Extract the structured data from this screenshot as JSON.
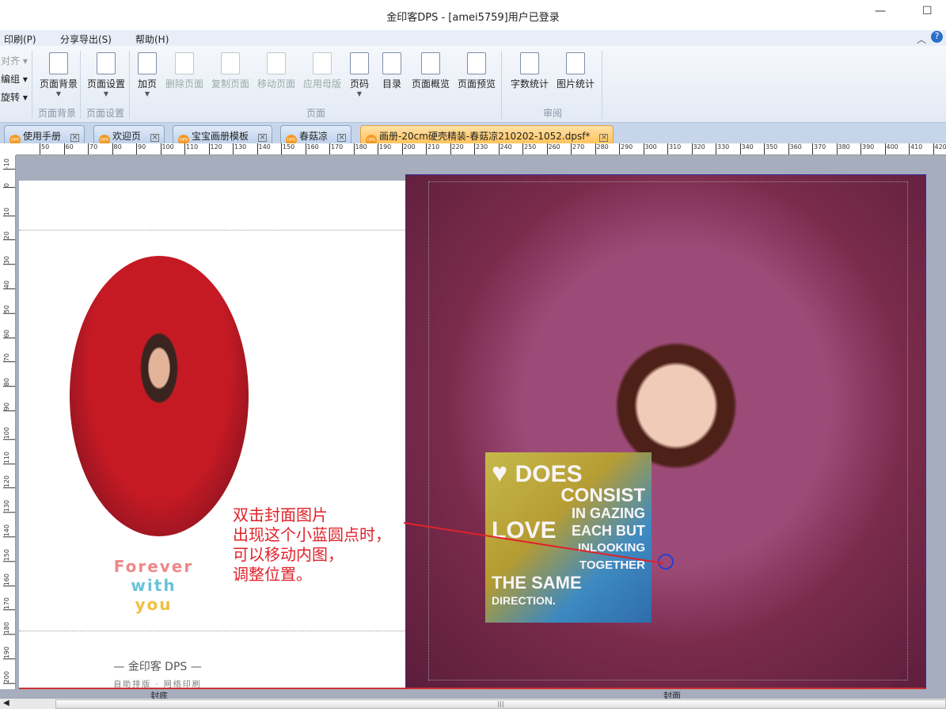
{
  "window": {
    "title": "金印客DPS - [amei5759]用户已登录",
    "minimize": "—",
    "maximize": "☐"
  },
  "menu": [
    "印刷(P)",
    "分享导出(S)",
    "帮助(H)"
  ],
  "side_tools": [
    "对齐",
    "编组",
    "旋转"
  ],
  "ribbon": {
    "buttons": [
      {
        "label": "页面背景",
        "icon": "page-background-icon",
        "enabled": true,
        "dropdown": true
      },
      {
        "label": "页面设置",
        "icon": "page-setup-icon",
        "enabled": true,
        "dropdown": true
      },
      {
        "label": "加页",
        "icon": "add-page-icon",
        "enabled": true,
        "dropdown": true
      },
      {
        "label": "删除页面",
        "icon": "delete-page-icon",
        "enabled": false
      },
      {
        "label": "复制页面",
        "icon": "copy-page-icon",
        "enabled": false
      },
      {
        "label": "移动页面",
        "icon": "move-page-icon",
        "enabled": false
      },
      {
        "label": "应用母版",
        "icon": "apply-master-icon",
        "enabled": false
      },
      {
        "label": "页码",
        "icon": "page-number-icon",
        "enabled": true,
        "dropdown": true
      },
      {
        "label": "目录",
        "icon": "toc-icon",
        "enabled": true
      },
      {
        "label": "页面概览",
        "icon": "page-overview-icon",
        "enabled": true
      },
      {
        "label": "页面预览",
        "icon": "page-preview-icon",
        "enabled": true
      },
      {
        "label": "字数统计",
        "icon": "word-count-icon",
        "enabled": true
      },
      {
        "label": "图片统计",
        "icon": "image-count-icon",
        "enabled": true
      }
    ],
    "groups": [
      "页面背景",
      "页面设置",
      "页面",
      "审阅"
    ]
  },
  "tabs": [
    {
      "label": "使用手册",
      "active": false
    },
    {
      "label": "欢迎页",
      "active": false
    },
    {
      "label": "宝宝画册模板",
      "active": false
    },
    {
      "label": "春菇凉",
      "active": false
    },
    {
      "label": "画册-20cm硬壳精装-春菇凉210202-1052.dpsf*",
      "active": true
    }
  ],
  "ruler": {
    "h_start": 50,
    "h_end": 420,
    "v_start": -10,
    "v_end": 200
  },
  "page": {
    "back_label": "封底",
    "front_label": "封面",
    "forever_text": [
      "Forever",
      "with",
      "you"
    ],
    "logo": "— 金印客 DPS —",
    "logo_sub": "自助排版 · 网络印刷",
    "text_art": [
      "DOES",
      "CONSIST",
      "IN GAZING",
      "EACH",
      "BUT",
      "LOVE",
      "INLOOKING",
      "TOGETHER",
      "THE SAME",
      "DIRECTION."
    ],
    "annotation": [
      "双击封面图片",
      "出现这个小蓝圆点时，",
      "可以移动内图，",
      "调整位置。"
    ],
    "annotation_color": "#e0222a"
  }
}
